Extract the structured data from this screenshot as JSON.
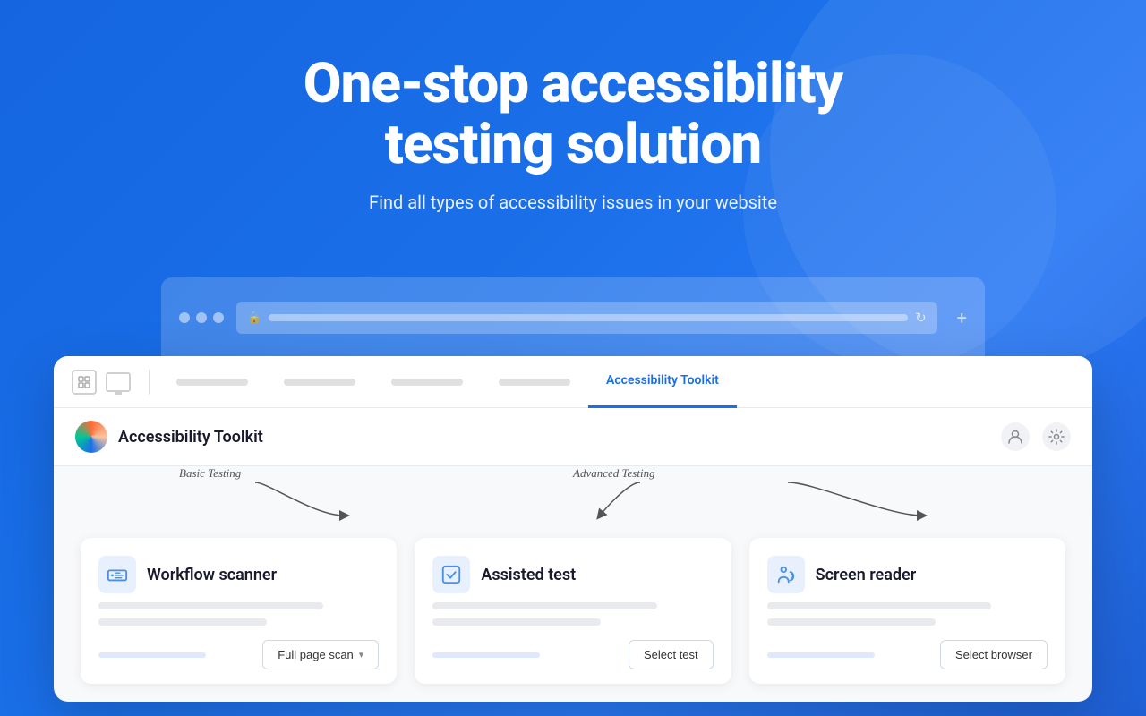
{
  "hero": {
    "title": "One-stop accessibility\ntesting solution",
    "subtitle": "Find all types of accessibility issues in your website"
  },
  "browser": {
    "tab_label": "Accessibility Toolkit"
  },
  "extension": {
    "title": "Accessibility Toolkit",
    "tabs": [
      {
        "id": "tab1",
        "label": "",
        "active": false
      },
      {
        "id": "tab2",
        "label": "",
        "active": false
      },
      {
        "id": "tab3",
        "label": "",
        "active": false
      },
      {
        "id": "tab4",
        "label": "",
        "active": false
      },
      {
        "id": "tab-active",
        "label": "Accessibility Toolkit",
        "active": true
      }
    ],
    "annotations": {
      "basic": "Basic Testing",
      "advanced": "Advanced Testing"
    },
    "cards": [
      {
        "id": "workflow-scanner",
        "name": "Workflow scanner",
        "icon": "scanner",
        "btn_label": "Full page scan",
        "has_chevron": true
      },
      {
        "id": "assisted-test",
        "name": "Assisted test",
        "icon": "check",
        "btn_label": "Select test",
        "has_chevron": false
      },
      {
        "id": "screen-reader",
        "name": "Screen reader",
        "icon": "person",
        "btn_label": "Select browser",
        "has_chevron": false
      }
    ]
  }
}
